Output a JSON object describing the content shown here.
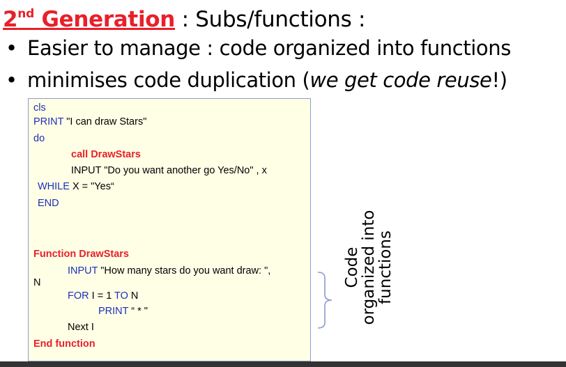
{
  "title": {
    "gen_number": "2",
    "gen_suffix": "nd",
    "gen_word": "Generation",
    "rest": " : Subs/functions :"
  },
  "bullets": {
    "bullet_char": "•",
    "b1": "Easier to manage : code organized into functions",
    "b2_pre": "minimises code duplication (",
    "b2_em": "we get code reuse",
    "b2_post": "!)"
  },
  "code": {
    "l1": "cls",
    "l2_kw": "PRINT",
    "l2_txt": " \"I can draw Stars\"",
    "l3": "do",
    "l4": "call DrawStars",
    "l5_kw": "INPUT",
    "l5_txt": " \"Do you want another go Yes/No\" , x",
    "l6_kw": "WHILE",
    "l6_txt": " X = \"Yes“",
    "l7": "END",
    "l8": "Function DrawStars",
    "l9_kw": "INPUT",
    "l9_txt": " \"How many stars do you want draw: \",",
    "l10": "N",
    "l11_kw": "FOR",
    "l11_txt": " I = 1 ",
    "l11_kw2": "TO",
    "l11_txt2": " N",
    "l12_kw": "PRINT",
    "l12_txt": " “ * \"",
    "l13_kw": "Next",
    "l13_txt": " I",
    "l14": "End function"
  },
  "side_label": {
    "line1": "Code",
    "line2": "organized into",
    "line3": "functions"
  },
  "colors": {
    "accent_red": "#e8202a",
    "keyword_blue": "#1e2fb8",
    "code_background": "#ffffe6"
  }
}
